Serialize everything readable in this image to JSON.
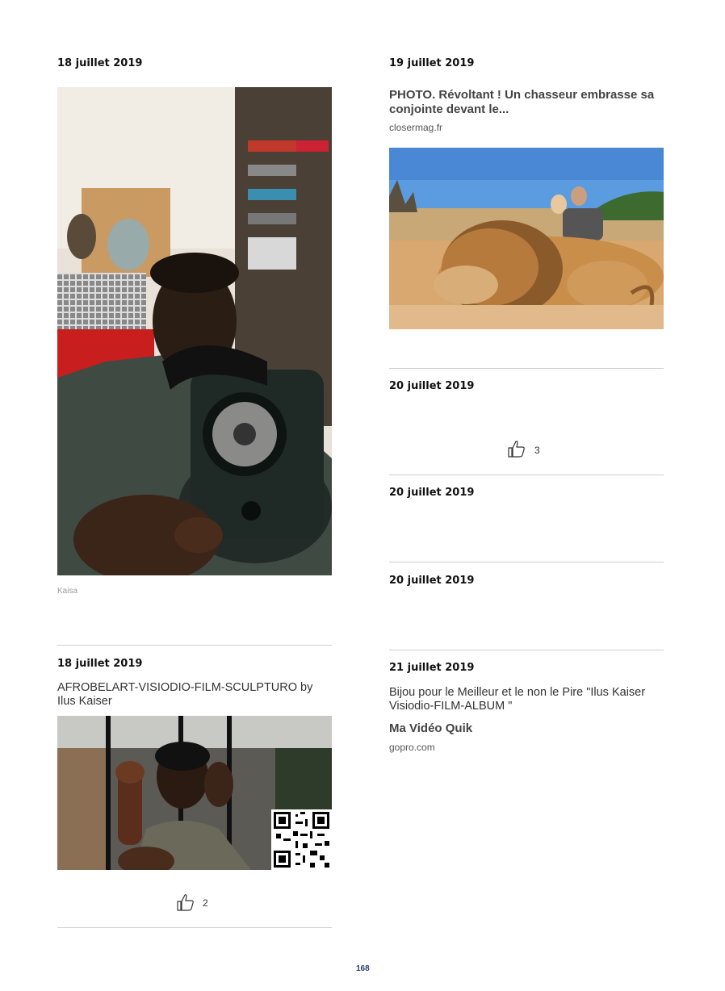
{
  "left": {
    "post1": {
      "date": "18 juillet 2019",
      "image_alt": "Homme tenant un téléphone à cadran ancien",
      "caption": "Kaisa"
    },
    "post2": {
      "date": "18 juillet 2019",
      "text": "AFROBELART-VISIODIO-FILM-SCULPTURO by Ilus Kaiser",
      "image_alt": "Homme avec sculpture et QR code",
      "likes": "2"
    }
  },
  "right": {
    "post1": {
      "date": "19 juillet 2019",
      "link_title": "PHOTO. Révoltant ! Un chasseur embrasse sa conjointe devant le...",
      "source": "closermag.fr",
      "image_alt": "Couple derrière un lion mort dans la savane"
    },
    "post2": {
      "date": "20 juillet 2019",
      "likes": "3"
    },
    "post3": {
      "date": "20 juillet 2019"
    },
    "post4": {
      "date": "20 juillet 2019"
    },
    "post5": {
      "date": "21 juillet 2019",
      "text": "Bijou pour le Meilleur et le non le Pire \"Ilus Kaiser Visiodio-FILM-ALBUM \"",
      "link_title": "Ma Vidéo Quik",
      "source": "gopro.com"
    }
  },
  "footer": {
    "page_number": "168"
  },
  "icons": {
    "like": "thumbs-up-icon",
    "qr": "qr-code-icon"
  }
}
